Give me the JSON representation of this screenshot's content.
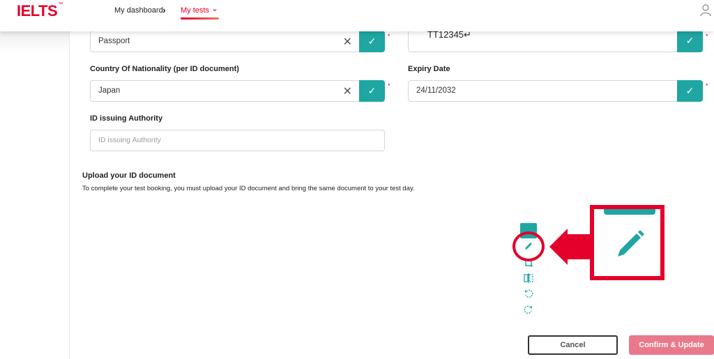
{
  "header": {
    "logo": "IELTS",
    "logo_mark": "™",
    "nav": {
      "dashboard": "My dashboard",
      "my_tests": "My tests"
    }
  },
  "form": {
    "id_type": {
      "value": "Passport"
    },
    "id_number": {
      "value": "TT12345↵"
    },
    "nationality": {
      "label": "Country Of Nationality (per ID document)",
      "value": "Japan"
    },
    "expiry": {
      "label": "Expiry Date",
      "value": "24/11/2032"
    },
    "authority": {
      "label": "ID issuing Authority",
      "placeholder": "ID issuing Authority"
    },
    "required_mark": "*"
  },
  "upload": {
    "title": "Upload your ID document",
    "description": "To complete your test booking, you must upload your ID document and bring the same document to your test day."
  },
  "toolbar": {
    "icons": [
      "pencil-icon",
      "crop-icon",
      "flip-icon",
      "rotate-left-icon",
      "rotate-right-icon"
    ]
  },
  "actions": {
    "cancel": "Cancel",
    "confirm": "Confirm & Update"
  },
  "colors": {
    "brand_red": "#e4002b",
    "teal": "#1fa6a3",
    "confirm_disabled": "#e97a8b"
  }
}
